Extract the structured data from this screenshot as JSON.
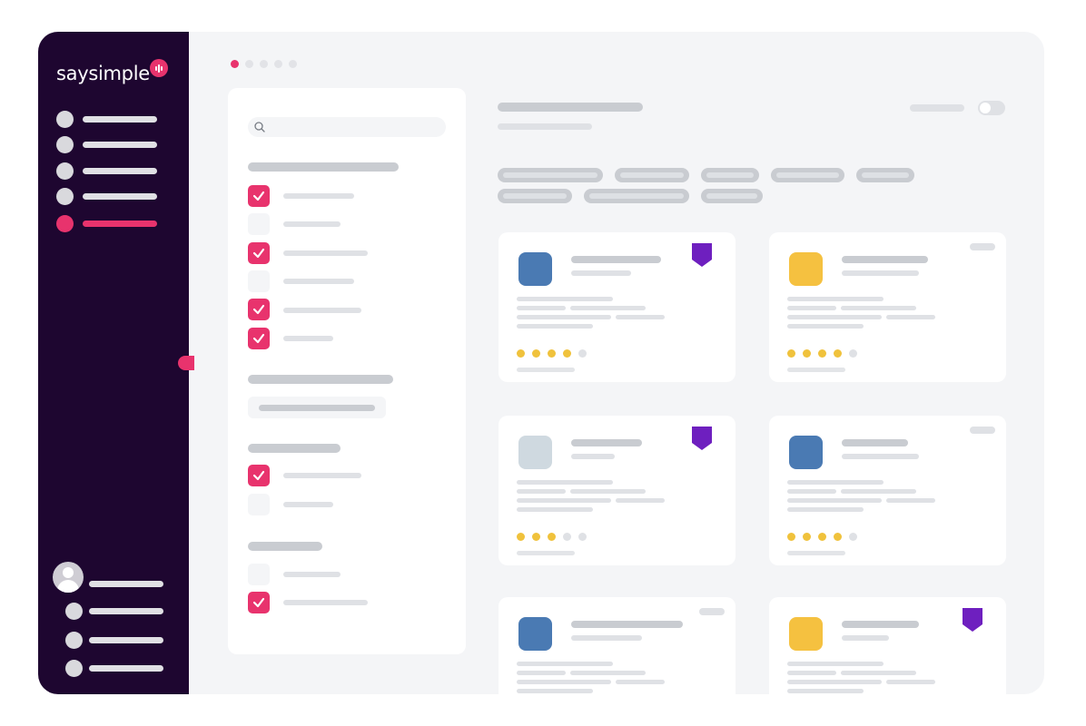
{
  "app": {
    "brand": "saysimple",
    "accent": "#e8336d",
    "sidebar_bg": "#1e0630",
    "badge_color": "#6e1fbf"
  },
  "sidebar": {
    "nav_items": [
      {
        "icon": "circle-icon",
        "active": false
      },
      {
        "icon": "circle-icon",
        "active": false
      },
      {
        "icon": "circle-icon",
        "active": false
      },
      {
        "icon": "circle-icon",
        "active": false
      },
      {
        "icon": "circle-icon",
        "active": true
      }
    ],
    "bottom_items": [
      {
        "icon": "user-avatar-icon"
      },
      {
        "icon": "circle-icon"
      },
      {
        "icon": "circle-icon"
      },
      {
        "icon": "circle-icon"
      }
    ]
  },
  "pager": {
    "count": 5,
    "active_index": 0
  },
  "filters": {
    "search_icon": "search-icon",
    "sections": [
      {
        "options_checked": [
          true,
          false,
          true,
          false,
          true,
          true
        ]
      },
      {
        "type": "select"
      },
      {
        "options_checked": [
          true,
          false
        ]
      },
      {
        "options_checked": [
          false,
          true
        ]
      }
    ]
  },
  "content": {
    "toggle_on": false,
    "chip_count": 8
  },
  "cards": [
    {
      "logo_color": "#4a7ab3",
      "rating": 4,
      "bookmarked": true
    },
    {
      "logo_color": "#f5c140",
      "rating": 4,
      "bookmarked": false
    },
    {
      "logo_color": "#cfd9e0",
      "rating": 3,
      "bookmarked": true
    },
    {
      "logo_color": "#4a7ab3",
      "rating": 4,
      "bookmarked": false
    },
    {
      "logo_color": "#4a7ab3",
      "rating": 0,
      "bookmarked": false
    },
    {
      "logo_color": "#f5c140",
      "rating": 0,
      "bookmarked": true
    }
  ],
  "rating_max": 5
}
